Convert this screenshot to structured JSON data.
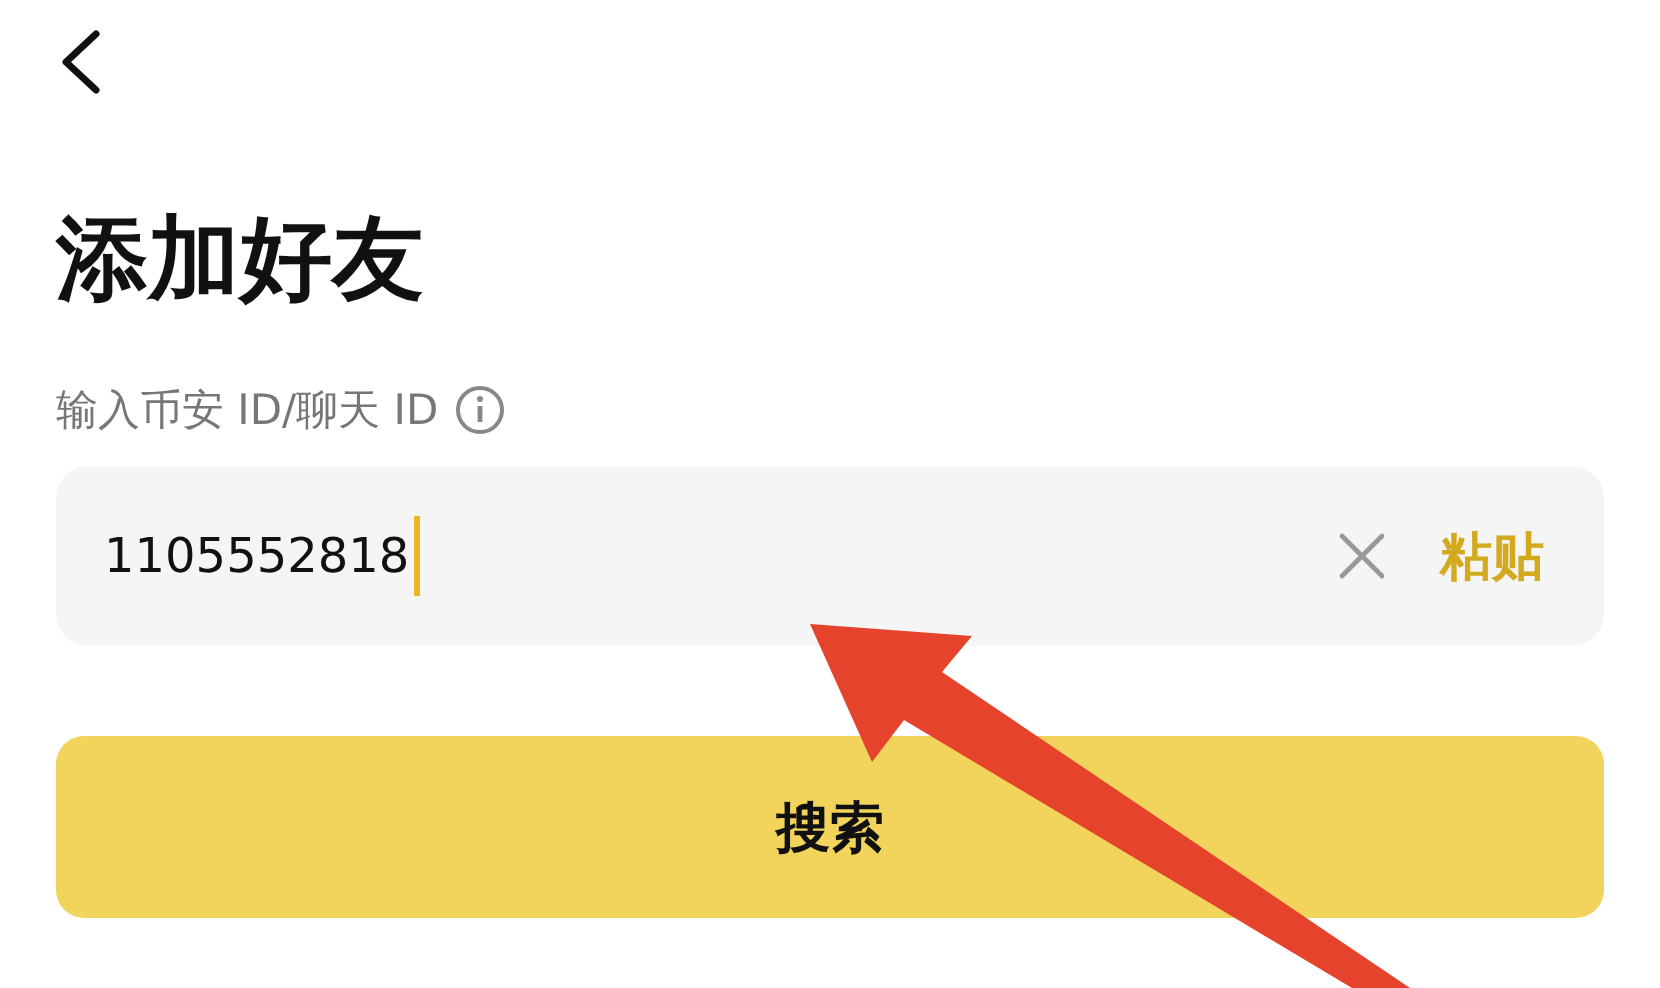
{
  "title": "添加好友",
  "field": {
    "label": "输入币安 ID/聊天 ID",
    "value": "1105552818",
    "action": "粘贴"
  },
  "button": {
    "label": "搜索"
  }
}
